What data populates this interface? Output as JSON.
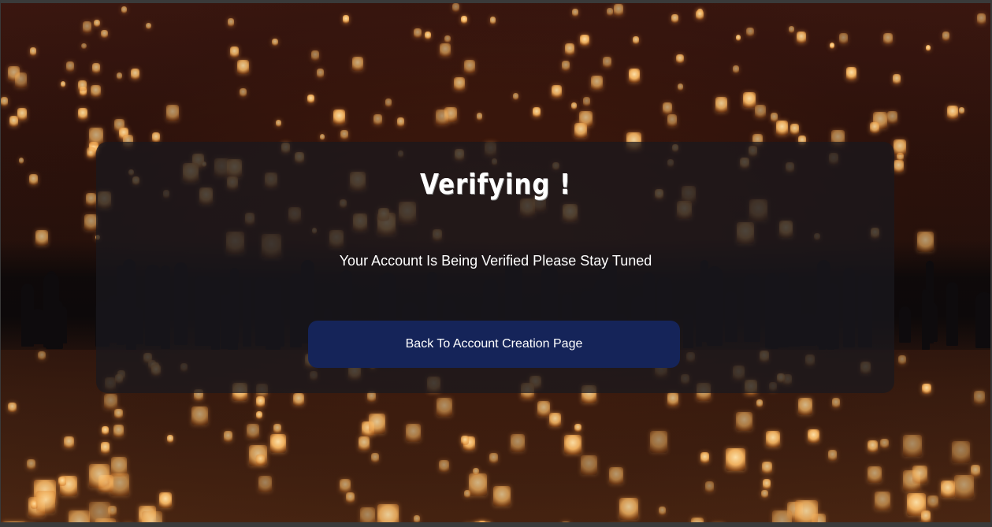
{
  "verification": {
    "title": "Verifying !",
    "message": "Your Account Is Being Verified Please Stay Tuned",
    "back_button_label": "Back To Account Creation Page"
  },
  "colors": {
    "card_background": "#19181e",
    "button_background": "#152459",
    "text": "#ffffff",
    "lantern_glow": "#f2b260"
  }
}
